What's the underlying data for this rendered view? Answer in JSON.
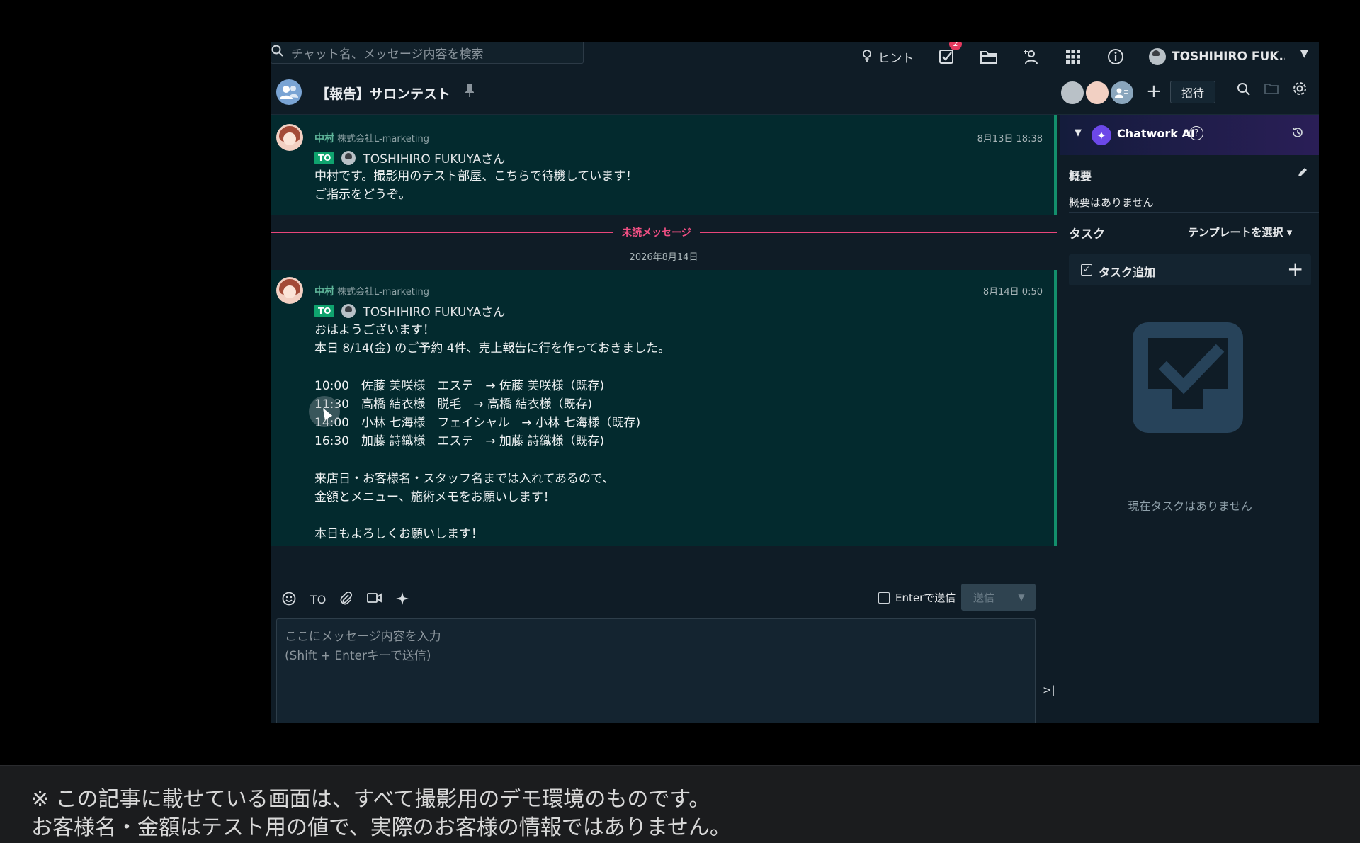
{
  "topbar": {
    "search_placeholder": "チャット名、メッセージ内容を検索",
    "hint_label": "ヒント",
    "task_badge": "2",
    "user_name": "TOSHIHIRO FUK..."
  },
  "room": {
    "title": "【報告】サロンテスト",
    "invite_label": "招待"
  },
  "messages": [
    {
      "sender": "中村",
      "org": "株式会社L-marketing",
      "time": "8月13日 18:38",
      "to_tag": "TO",
      "to_name": "TOSHIHIRO FUKUYAさん",
      "lines": [
        "中村です。撮影用のテスト部屋、こちらで待機しています！",
        "ご指示をどうぞ。"
      ]
    },
    {
      "sender": "中村",
      "org": "株式会社L-marketing",
      "time": "8月14日 0:50",
      "to_tag": "TO",
      "to_name": "TOSHIHIRO FUKUYAさん",
      "lines": [
        "おはようございます！",
        "本日 8/14(金) のご予約 4件、売上報告に行を作っておきました。",
        "",
        "10:00　佐藤 美咲様　エステ　→ 佐藤 美咲様（既存)",
        "11:30　高橋 結衣様　脱毛　→ 高橋 結衣様（既存)",
        "14:00　小林 七海様　フェイシャル　→ 小林 七海様（既存)",
        "16:30　加藤 詩織様　エステ　→ 加藤 詩織様（既存)",
        "",
        "来店日・お客様名・スタッフ名までは入れてあるので、",
        "金額とメニュー、施術メモをお願いします！",
        "",
        "本日もよろしくお願いします！"
      ]
    }
  ],
  "separator": {
    "unread_label": "未読メッセージ",
    "date_label": "2026年8月14日"
  },
  "composer": {
    "to_label": "TO",
    "enter_send_label": "Enterで送信",
    "send_label": "送信",
    "placeholder": "ここにメッセージ内容を入力\n(Shift + Enterキーで送信)"
  },
  "rightpanel": {
    "ai_title": "Chatwork AI",
    "help_glyph": "?",
    "summary_head": "概要",
    "summary_text": "概要はありません",
    "task_head": "タスク",
    "template_select": "テンプレートを選択 ▾",
    "task_add_label": "タスク追加",
    "empty_text": "現在タスクはありません"
  },
  "caption": {
    "line1": "※ この記事に載せている画面は、すべて撮影用のデモ環境のものです。",
    "line2": "お客様名・金額はテスト用の値で、実際のお客様の情報ではありません。"
  },
  "icons": {
    "search": "search-icon",
    "hint": "lightbulb-icon",
    "tasks": "task-check-icon",
    "files": "folder-icon",
    "contacts": "add-contact-icon",
    "apps": "grid-icon",
    "info": "info-icon",
    "pin": "pin-icon",
    "gear": "gear-icon",
    "history": "history-icon",
    "edit": "pencil-icon"
  },
  "colors": {
    "app_bg": "#0f1c26",
    "message_bg": "#032a2e",
    "accent_green": "#0fa36e",
    "unread_pink": "#e8467a",
    "ai_purple": "#6c48e8"
  }
}
